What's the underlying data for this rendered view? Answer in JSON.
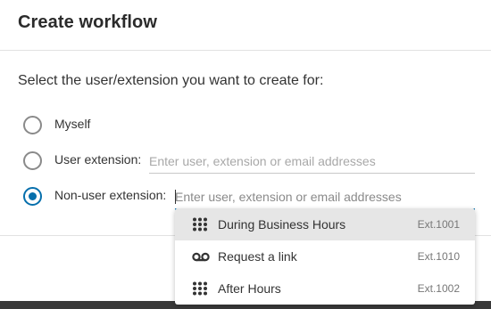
{
  "dialog": {
    "title": "Create workflow",
    "prompt": "Select the user/extension you want to create for:"
  },
  "options": {
    "myself": {
      "label": "Myself",
      "checked": false
    },
    "user_extension": {
      "label": "User extension:",
      "checked": false,
      "input_value": "",
      "placeholder": "Enter user, extension or email addresses"
    },
    "non_user_extension": {
      "label": "Non-user extension:",
      "checked": true,
      "input_value": "",
      "placeholder": "Enter user, extension or email addresses"
    }
  },
  "dropdown": {
    "items": [
      {
        "label": "During Business Hours",
        "ext": "Ext.1001",
        "icon": "dialpad-icon",
        "highlighted": true
      },
      {
        "label": "Request a link",
        "ext": "Ext.1010",
        "icon": "voicemail-icon",
        "highlighted": false
      },
      {
        "label": "After Hours",
        "ext": "Ext.1002",
        "icon": "dialpad-icon",
        "highlighted": false
      }
    ]
  },
  "colors": {
    "accent": "#066fac",
    "highlight": "#e6e6e6",
    "backdrop": "#3a3a3a"
  }
}
